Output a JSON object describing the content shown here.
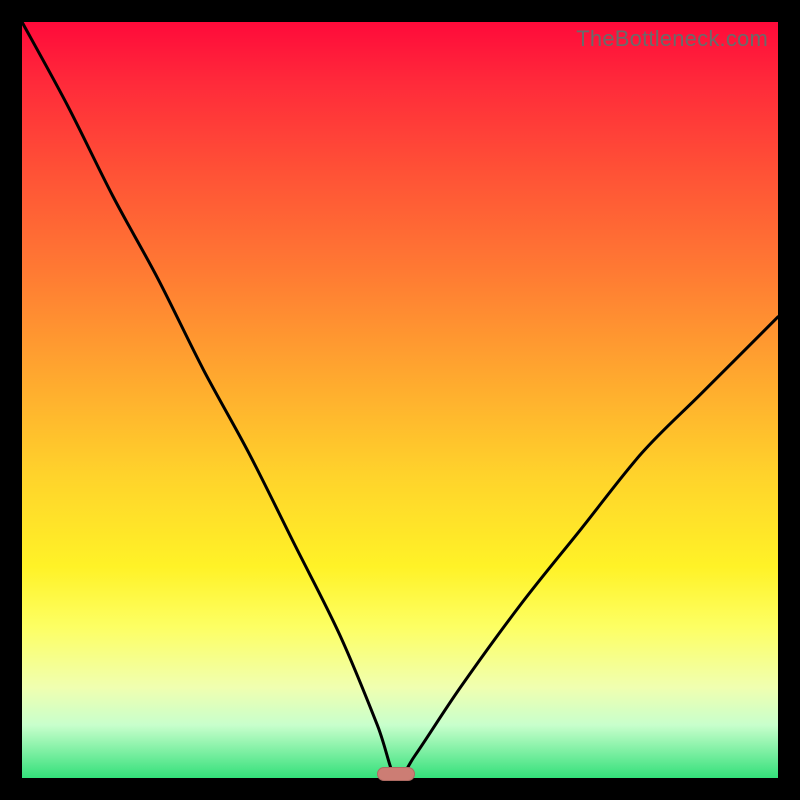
{
  "watermark": "TheBottleneck.com",
  "chart_data": {
    "type": "line",
    "title": "",
    "xlabel": "",
    "ylabel": "",
    "xlim": [
      0,
      100
    ],
    "ylim": [
      0,
      100
    ],
    "grid": false,
    "series": [
      {
        "name": "bottleneck-curve",
        "x": [
          0,
          6,
          12,
          18,
          24,
          30,
          36,
          42,
          47,
          49.5,
          52,
          58,
          66,
          74,
          82,
          90,
          100
        ],
        "y": [
          100,
          89,
          77,
          66,
          54,
          43,
          31,
          19,
          7,
          0,
          3,
          12,
          23,
          33,
          43,
          51,
          61
        ]
      }
    ],
    "marker": {
      "x": 49.5,
      "y": 0
    },
    "background_gradient": {
      "top": "#ff0a3a",
      "mid": "#ffe627",
      "bottom": "#33e07a"
    }
  }
}
